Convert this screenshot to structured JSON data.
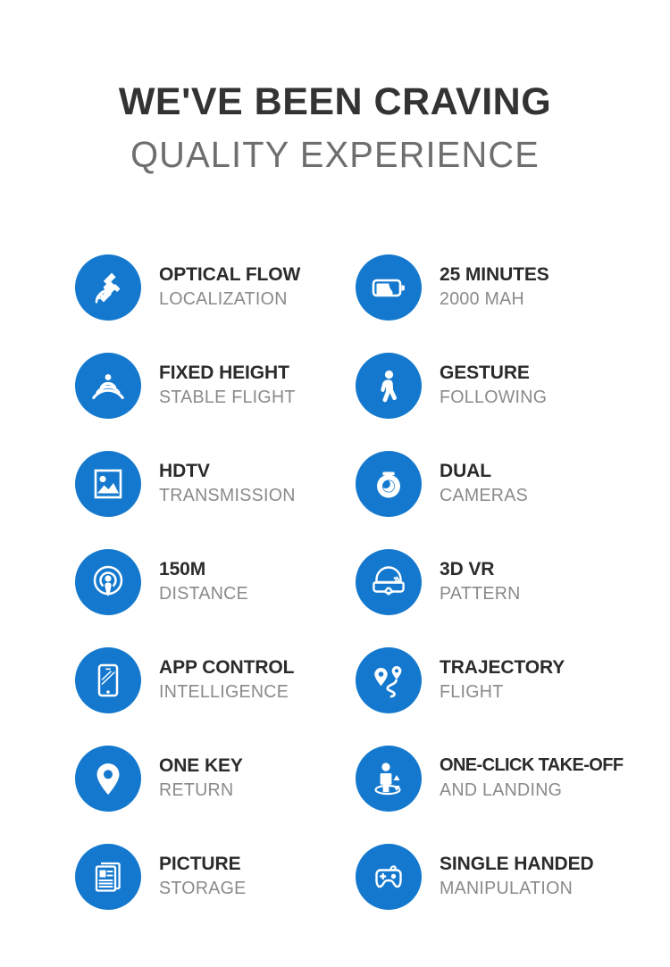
{
  "heading": {
    "line1": "WE'VE BEEN CRAVING",
    "line2": "QUALITY EXPERIENCE"
  },
  "colors": {
    "icon_blue": "#1479ce",
    "title_dark": "#2b2b2b",
    "subtitle_gray": "#8a8a8a",
    "heading_light": "#6e6e6e",
    "background": "#ffffff"
  },
  "features": [
    {
      "icon": "satellite-icon",
      "title": "OPTICAL FLOW",
      "subtitle": "LOCALIZATION"
    },
    {
      "icon": "battery-icon",
      "title": "25 MINUTES",
      "subtitle": "2000 MAH"
    },
    {
      "icon": "sonar-waves-icon",
      "title": "FIXED HEIGHT",
      "subtitle": "STABLE FLIGHT"
    },
    {
      "icon": "walking-person-icon",
      "title": "GESTURE",
      "subtitle": "FOLLOWING"
    },
    {
      "icon": "photo-icon",
      "title": "HDTV",
      "subtitle": "TRANSMISSION"
    },
    {
      "icon": "webcam-icon",
      "title": "DUAL",
      "subtitle": "CAMERAS"
    },
    {
      "icon": "broadcast-icon",
      "title": "150M",
      "subtitle": "DISTANCE"
    },
    {
      "icon": "vr-headset-icon",
      "title": "3D VR",
      "subtitle": "PATTERN"
    },
    {
      "icon": "smartphone-icon",
      "title": "APP CONTROL",
      "subtitle": "INTELLIGENCE"
    },
    {
      "icon": "route-pins-icon",
      "title": "TRAJECTORY",
      "subtitle": "FLIGHT"
    },
    {
      "icon": "map-pin-icon",
      "title": "ONE KEY",
      "subtitle": "RETURN"
    },
    {
      "icon": "takeoff-person-icon",
      "title": "ONE-CLICK TAKE-OFF",
      "subtitle": "AND LANDING"
    },
    {
      "icon": "documents-icon",
      "title": "PICTURE",
      "subtitle": "STORAGE"
    },
    {
      "icon": "gamepad-icon",
      "title": "SINGLE HANDED",
      "subtitle": "MANIPULATION"
    }
  ]
}
